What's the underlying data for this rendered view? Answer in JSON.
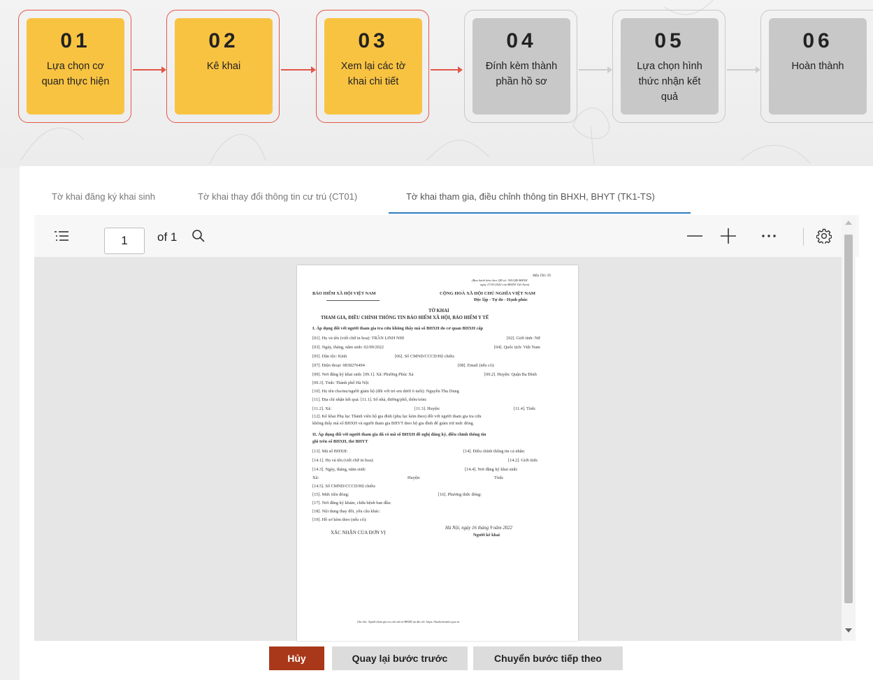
{
  "stepper": {
    "steps": [
      {
        "num": "01",
        "label": "Lựa chọn cơ quan thực hiện",
        "state": "active"
      },
      {
        "num": "02",
        "label": "Kê khai",
        "state": "active"
      },
      {
        "num": "03",
        "label": "Xem lại các tờ khai chi tiết",
        "state": "active"
      },
      {
        "num": "04",
        "label": "Đính kèm thành phần hồ sơ",
        "state": "inactive"
      },
      {
        "num": "05",
        "label": "Lựa chọn hình thức nhận kết quả",
        "state": "inactive"
      },
      {
        "num": "06",
        "label": "Hoàn thành",
        "state": "inactive"
      }
    ],
    "colors": {
      "active_card": "#f9c342",
      "active_border": "#e1574a",
      "inactive_card": "#c8c8c8"
    }
  },
  "tabs": [
    {
      "label": "Tờ khai đăng ký khai sinh",
      "selected": false
    },
    {
      "label": "Tờ khai thay đổi thông tin cư trú (CT01)",
      "selected": false
    },
    {
      "label": "Tờ khai tham gia, điều chỉnh thông tin BHXH, BHYT (TK1-TS)",
      "selected": true
    }
  ],
  "viewer": {
    "current_page": "1",
    "total_pages": "of 1",
    "icons": [
      "list-icon",
      "search-icon",
      "zoom-out-icon",
      "zoom-in-icon",
      "more-icon",
      "settings-icon"
    ]
  },
  "document": {
    "form_code": "Mẫu TK1-TS",
    "form_ref1": "(Ban hành kèm theo QĐ số: 505/QĐ-BHXH",
    "form_ref2": "ngày 27/03/2020 của BHXH Việt Nam)",
    "left_header": "BẢO HIỂM XÃ HỘI VIỆT NAM",
    "right_header": "CỘNG HOÀ XÃ HỘI CHỦ NGHĨA VIỆT NAM",
    "motto": "Độc lập - Tự do - Hạnh phúc",
    "title": "TỜ KHAI",
    "subtitle": "THAM GIA, ĐIỀU CHỈNH THÔNG TIN BẢO HIỂM XÃ HỘI, BẢO HIỂM Y TẾ",
    "section1": "I. Áp dụng đối với người tham gia tra cứu không thấy mã số BHXH do cơ quan BHXH cấp",
    "l01a": "[01]. Họ và tên (viết chữ in hoa): TRẦN LINH NHI",
    "l01b": "[02]. Giới tính: Nữ",
    "l03a": "[03]. Ngày, tháng, năm sinh: 02/09/2022",
    "l03b": "[04]. Quốc tịch: Việt Nam",
    "l05a": "[05]. Dân tộc: Kinh",
    "l05b": "[06]. Số CMND/CCCD/Hộ chiếu:",
    "l07a": "[07]. Điện thoại: 0838276494",
    "l07b": "[08]. Email (nếu có):",
    "l09a": "[09]. Nơi đăng ký khai sinh: [09.1]. Xã: Phường Phúc Xá",
    "l09b": "[09.2]. Huyện: Quận Ba Đình",
    "l093": "[09.3]. Tỉnh: Thành phố Hà Nội",
    "l10": "[10]. Họ tên cha/mẹ/người giám hộ (đối với trẻ em dưới 6 tuổi): Nguyễn Thu Dung",
    "l11": "[11]. Địa chỉ nhận kết quả: [11.1]. Số nhà, đường/phố, thôn/xóm:",
    "l112a": "[11.2]. Xã:",
    "l112b": "[11.3]. Huyện:",
    "l112c": "[11.4]. Tỉnh:",
    "l12a": "[12]. Kê khai Phụ lục Thành viên hộ gia đình (phụ lục kèm theo) đối với người tham gia tra cứu",
    "l12b": "không thấy mã số BHXH và người tham gia BHYT theo hộ gia đình để giảm trừ mức đóng.",
    "section2a": "II. Áp dụng đối với người tham gia đã có mã số BHXH đề nghị đăng ký, điều chỉnh thông tin",
    "section2b": "ghi trên sổ BHXH, thẻ BHYT",
    "l13a": "[13]. Mã số BHXH:",
    "l13b": "[14]. Điều chỉnh thông tin cá nhân:",
    "l141a": "[14.1]. Họ và tên (viết chữ in hoa):",
    "l141b": "[14.2]. Giới tính:",
    "l143a": "[14.3]. Ngày, tháng, năm sinh:",
    "l143b": "[14.4]. Nơi đăng ký khai sinh:",
    "lxa": "Xã:",
    "lhuyen": "Huyện:",
    "ltinh": "Tỉnh:",
    "l145": "[14.5]. Số CMND/CCCD/Hộ chiếu:",
    "l15a": "[15]. Mức tiền đóng:",
    "l15b": "[16]. Phương thức đóng:",
    "l17": "[17]. Nơi đăng ký khám, chữa bệnh ban đầu:",
    "l18": "[18]. Nội dung thay đổi, yêu cầu khác:",
    "l19": "[19]. Hồ sơ kèm theo (nếu có):",
    "sign_date": "Hà Nội, ngày 16 tháng 9 năm 2022",
    "sign_left": "XÁC NHẬN CỦA ĐƠN VỊ",
    "sign_right": "Người kê khai",
    "footnote": "Ghi chú: Người tham gia tra cứu mã số BHXH tại địa chỉ: https://baohiemxahoi.gov.vn"
  },
  "buttons": {
    "cancel": "Hủy",
    "back": "Quay lại bước trước",
    "next": "Chuyển bước tiếp theo"
  }
}
